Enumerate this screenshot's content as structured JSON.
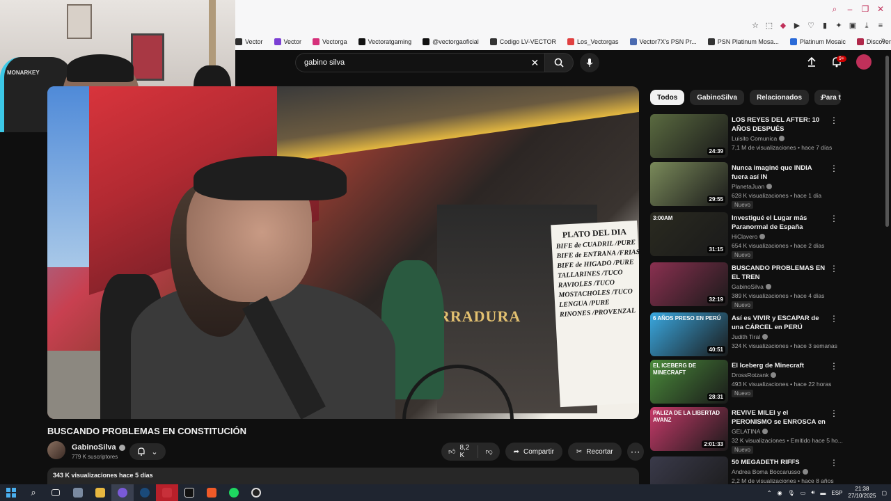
{
  "browser": {
    "bookmarks": [
      {
        "label": "Vector",
        "color": "#2d2d2d"
      },
      {
        "label": "Vector",
        "color": "#7b3fd4"
      },
      {
        "label": "Vectorga",
        "color": "#d6307a"
      },
      {
        "label": "Vectoratgaming",
        "color": "#111111"
      },
      {
        "label": "@vectorgaoficial",
        "color": "#111111"
      },
      {
        "label": "Codigo LV-VECTOR",
        "color": "#333333"
      },
      {
        "label": "Los_Vectorgas",
        "color": "#e04040"
      },
      {
        "label": "Vector7X's PSN Pr...",
        "color": "#4a6ab0"
      },
      {
        "label": "PSN Platinum Mosa...",
        "color": "#333333"
      },
      {
        "label": "Platinum Mosaic",
        "color": "#2a6ad8"
      },
      {
        "label": "Discover Games -...",
        "color": "#b0284a"
      }
    ]
  },
  "webcam": {
    "chair_brand": "MONARKEY"
  },
  "search": {
    "value": "gabino silva"
  },
  "header": {
    "notifications_badge": "9+"
  },
  "player": {
    "sign_text": "RRADURA",
    "menu_title": "PLATO DEL DIA",
    "menu_lines": [
      "BIFE de CUADRIL /PURE",
      "BIFE de ENTRANA /FRIAS",
      "BIFE de HIGADO /PURE",
      "TALLARINES /TUCO",
      "RAVIOLES /TUCO",
      "MOSTACHOLES /TUCO",
      "LENGUA /PURE",
      "RINONES /PROVENZAL"
    ]
  },
  "video": {
    "title": "BUSCANDO PROBLEMAS EN CONSTITUCIÓN",
    "channel": "GabinoSilva",
    "subscribers": "779 K suscriptores",
    "likes": "8,2 K",
    "share_label": "Compartir",
    "clip_label": "Recortar",
    "views_date": "343 K visualizaciones  hace 5 días"
  },
  "chips": [
    "Todos",
    "GabinoSilva",
    "Relacionados",
    "Para ti"
  ],
  "recommendations": [
    {
      "title": "LOS REYES DEL AFTER: 10 AÑOS DESPUÉS",
      "channel": "Luisito Comunica",
      "meta": "7,1 M de visualizaciones • hace 7 días",
      "duration": "24:39",
      "nuevo": "",
      "thumb": "#5a6a40"
    },
    {
      "title": "Nunca imaginé que INDIA fuera así IN",
      "channel": "PlanetaJuan",
      "meta": "628 K visualizaciones • hace 1 día",
      "duration": "29:55",
      "nuevo": "Nuevo",
      "thumb": "#7a8a5a"
    },
    {
      "title": "Investigué el Lugar más Paranormal de España",
      "channel": "HiClavero",
      "meta": "654 K visualizaciones • hace 2 días",
      "duration": "31:15",
      "nuevo": "Nuevo",
      "thumb": "#2a2a20"
    },
    {
      "title": "BUSCANDO PROBLEMAS EN EL TREN",
      "channel": "GabinoSilva",
      "meta": "389 K visualizaciones • hace 4 días",
      "duration": "32:19",
      "nuevo": "Nuevo",
      "thumb": "#8a3050"
    },
    {
      "title": "Así es VIVIR y ESCAPAR de una CÁRCEL en PERÚ",
      "channel": "Judith Tiral",
      "meta": "324 K visualizaciones • hace 3 semanas",
      "duration": "40:51",
      "nuevo": "",
      "thumb": "#3aa8e0"
    },
    {
      "title": "El Iceberg de Minecraft",
      "channel": "DrossRotzank",
      "meta": "493 K visualizaciones • hace 22 horas",
      "duration": "28:31",
      "nuevo": "Nuevo",
      "thumb": "#4a8a3a"
    },
    {
      "title": "REVIVE MILEI y el PERONISMO se ENROSCA en la INTERNA | ...",
      "channel": "GELATINA",
      "meta": "32 K visualizaciones • Emitido hace 5 ho...",
      "duration": "2:01:33",
      "nuevo": "Nuevo",
      "thumb": "#c83a6a"
    },
    {
      "title": "50 MEGADETH RIFFS",
      "channel": "Andrea Boma Boccarusso",
      "meta": "2,2 M de visualizaciones • hace 8 años",
      "duration": "",
      "nuevo": "",
      "thumb": "#3a3a4a"
    }
  ],
  "thumb_texts": {
    "paranormal_overlay": "3:00AM",
    "prison_overlay": "6 AÑOS PRESO EN PERÚ",
    "minecraft_overlay": "EL ICEBERG DE MINECRAFT",
    "milei_overlay": "PALIZA DE LA LIBERTAD AVANZ"
  },
  "taskbar": {
    "lang": "ESP",
    "time": "21:38",
    "date": "27/10/2025"
  }
}
